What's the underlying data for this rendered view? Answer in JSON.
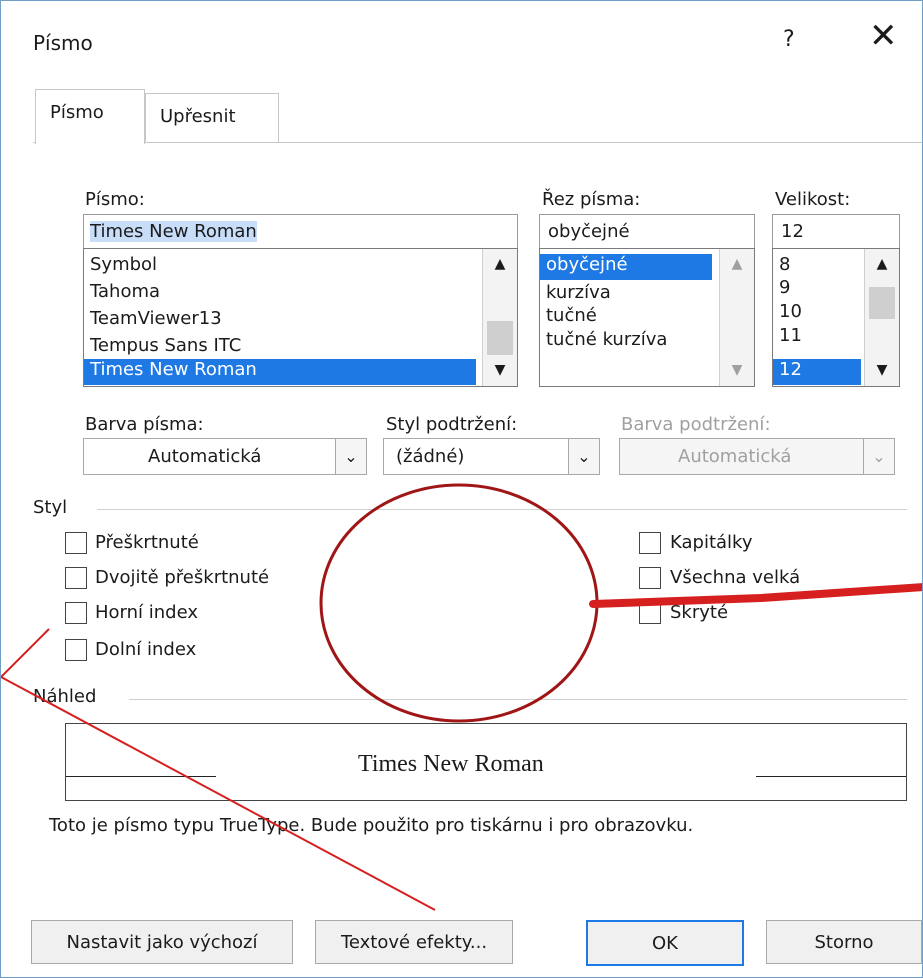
{
  "window": {
    "title": "Písmo",
    "help_glyph": "?",
    "close_glyph": "✕"
  },
  "tabs": [
    {
      "label": "Písmo"
    },
    {
      "label": "Upřesnit"
    }
  ],
  "font": {
    "label": "Písmo:",
    "value": "Times New Roman",
    "list": [
      "Symbol",
      "Tahoma",
      "TeamViewer13",
      "Tempus Sans ITC",
      "Times New Roman"
    ],
    "selected_index": 4
  },
  "style": {
    "label": "Řez písma:",
    "value": "obyčejné",
    "list": [
      "obyčejné",
      "kurzíva",
      "tučné",
      "tučné kurzíva"
    ],
    "selected_index": 0
  },
  "size": {
    "label": "Velikost:",
    "value": "12",
    "list": [
      "8",
      "9",
      "10",
      "11",
      "12"
    ],
    "selected_index": 4
  },
  "font_color": {
    "label": "Barva písma:",
    "value": "Automatická"
  },
  "underline_style": {
    "label": "Styl podtržení:",
    "value": "(žádné)"
  },
  "underline_color": {
    "label": "Barva podtržení:",
    "value": "Automatická"
  },
  "effects": {
    "group_label": "Styl",
    "left": [
      {
        "label": "Přeškrtnuté",
        "checked": false
      },
      {
        "label": "Dvojitě přeškrtnuté",
        "checked": false
      },
      {
        "label": "Horní index",
        "checked": false
      },
      {
        "label": "Dolní index",
        "checked": false
      }
    ],
    "right": [
      {
        "label": "Kapitálky",
        "checked": false
      },
      {
        "label": "Všechna velká",
        "checked": false
      },
      {
        "label": "Skryté",
        "checked": false
      }
    ]
  },
  "preview": {
    "group_label": "Náhled",
    "sample": "Times New Roman",
    "description": "Toto je písmo typu TrueType. Bude použito pro tiskárnu i pro obrazovku."
  },
  "buttons": {
    "default": "Nastavit jako výchozí",
    "effects": "Textové efekty...",
    "ok": "OK",
    "cancel": "Storno"
  },
  "annotation": {
    "color": "#d61f1f",
    "shape": "circle-with-arrow"
  }
}
